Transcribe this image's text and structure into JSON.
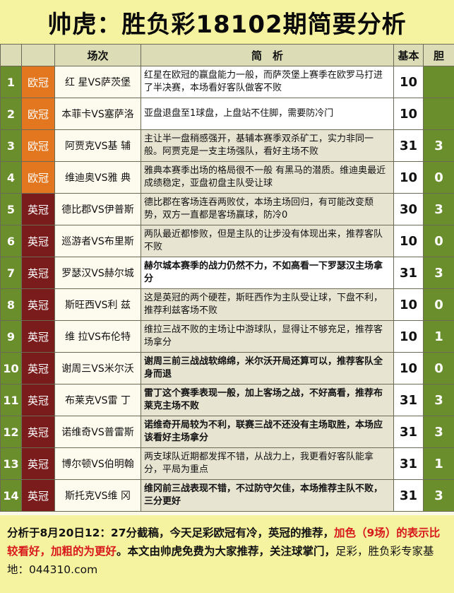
{
  "title": "帅虎：胜负彩18102期简要分析",
  "headers": {
    "col_match": "场次",
    "col_desc": "简　析",
    "col_basic": "基本",
    "col_dan": "胆"
  },
  "colors": {
    "ouguan": "#e2771f",
    "yingguan": "#7b1c1c",
    "num_bg": "#6a8e2c",
    "title_bg": "#f5f2a0",
    "highlight_red": "#d7191c"
  },
  "rows": [
    {
      "num": "1",
      "league": "欧冠",
      "match": "红 星VS萨茨堡",
      "desc": "红星在欧冠的赢盘能力一般，而萨茨堡上赛季在欧罗马打进了半决赛，本场看好客队做客不败",
      "basic": "10",
      "dan": ""
    },
    {
      "num": "2",
      "league": "欧冠",
      "match": "本菲卡VS塞萨洛",
      "desc": "亚盘退盘至1球盘，上盘站不住脚，需要防冷门",
      "basic": "10",
      "dan": ""
    },
    {
      "num": "3",
      "league": "欧冠",
      "match": "阿贾克VS基 辅",
      "desc": "主让半一盘稍感强开，基辅本赛季双杀矿工，实力非同一般。阿贾克是一支主场强队，看好主场不败",
      "basic": "31",
      "dan": "3"
    },
    {
      "num": "4",
      "league": "欧冠",
      "match": "维迪奥VS雅 典",
      "desc": "雅典本赛季出场的格局很不一般 有黑马的潜质。维迪奥最近成绩稳定，亚盘初盘主队受让球",
      "basic": "10",
      "dan": "0"
    },
    {
      "num": "5",
      "league": "英冠",
      "match": "德比郡VS伊普斯",
      "desc": "德比郡在客场连吞两败仗，本场主场回归，有可能改变颓势，双方一直都是客场赢球，防冷0",
      "basic": "30",
      "dan": "3"
    },
    {
      "num": "6",
      "league": "英冠",
      "match": "巡游者VS布里斯",
      "desc": "两队最近都惨败，但是主队的让步没有体现出来，推荐客队不败",
      "basic": "10",
      "dan": "0"
    },
    {
      "num": "7",
      "league": "英冠",
      "match": "罗瑟汉VS赫尔城",
      "desc": "赫尔城本赛季的战力仍然不力，不如高看一下罗瑟汉主场拿分",
      "basic": "31",
      "dan": "3"
    },
    {
      "num": "8",
      "league": "英冠",
      "match": "斯旺西VS利 兹",
      "desc": "这是英冠的两个硬茬，斯旺西作为主队受让球，下盘不利，推荐利兹客场不败",
      "basic": "10",
      "dan": "0"
    },
    {
      "num": "9",
      "league": "英冠",
      "match": "维 拉VS布伦特",
      "desc": "维拉三战不败的主场让中游球队，显得让不够充足，推荐客场拿分",
      "basic": "10",
      "dan": "1"
    },
    {
      "num": "10",
      "league": "英冠",
      "match": "谢周三VS米尔沃",
      "desc": "谢周三前三战战软绵绵，米尔沃开局还算可以，推荐客队全身而退",
      "basic": "10",
      "dan": "0"
    },
    {
      "num": "11",
      "league": "英冠",
      "match": "布莱克VS雷 丁",
      "desc": "雷丁这个赛季表现一般，加上客场之战，不好高看，推荐布莱克主场不败",
      "basic": "31",
      "dan": "3"
    },
    {
      "num": "12",
      "league": "英冠",
      "match": "诺维奇VS普雷斯",
      "desc": "诺维奇开局较为不利，联赛三战不还没有主场取胜，本场应该看好主场拿分",
      "basic": "31",
      "dan": "3"
    },
    {
      "num": "13",
      "league": "英冠",
      "match": "博尔顿VS伯明翰",
      "desc": "两支球队近期都发挥不错，从战力上，我更看好客队能拿分，平局为重点",
      "basic": "31",
      "dan": "1"
    },
    {
      "num": "14",
      "league": "英冠",
      "match": "斯托克VS维 冈",
      "desc": "维冈前三战表现不错，不过防守欠佳，本场推荐主队不败，三分更好",
      "basic": "31",
      "dan": "3"
    }
  ],
  "footer": {
    "part1": "分析于8月20日12：27分截稿，今天足彩欧冠有冷，英冠的推荐，",
    "part2": "加色（9场）的表示比较看好，加粗的为更好",
    "part3": "。本文由帅虎免费为大家推荐，关注球掌门，",
    "part4": "足彩，胜负彩专家基地：044310.com"
  }
}
